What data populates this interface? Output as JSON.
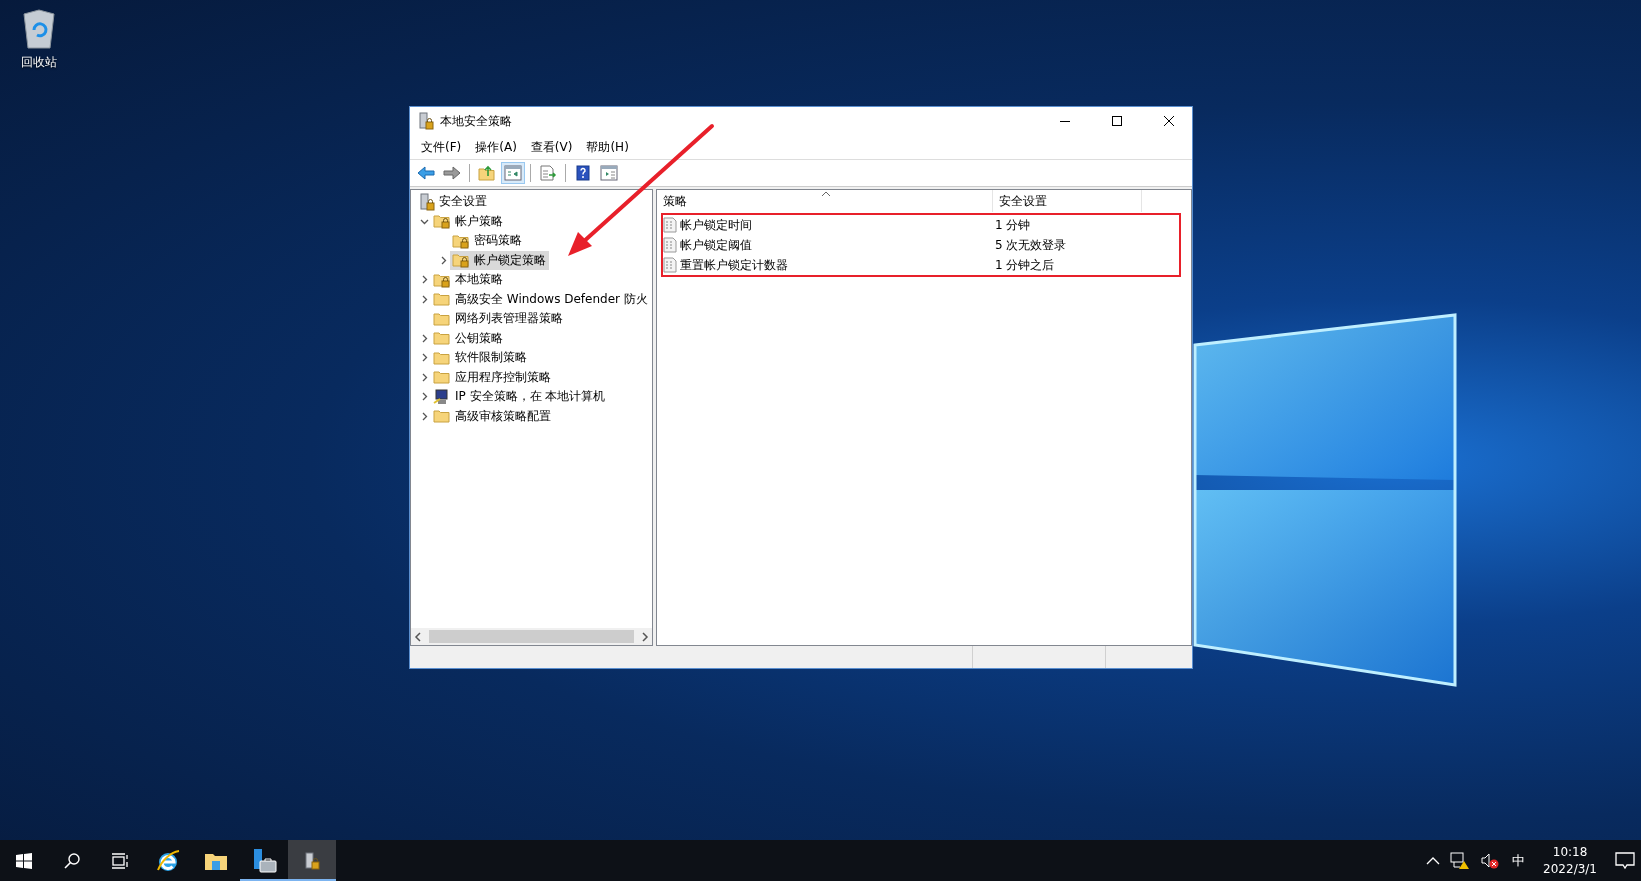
{
  "desktop": {
    "icons": [
      {
        "label": "回收站"
      }
    ]
  },
  "window": {
    "title": "本地安全策略",
    "menu": [
      "文件(F)",
      "操作(A)",
      "查看(V)",
      "帮助(H)"
    ],
    "toolbar": [
      {
        "kind": "back",
        "pressed": false
      },
      {
        "kind": "forward",
        "pressed": false
      },
      {
        "kind": "sep"
      },
      {
        "kind": "up",
        "pressed": false
      },
      {
        "kind": "tree",
        "pressed": true
      },
      {
        "kind": "sep"
      },
      {
        "kind": "export",
        "pressed": false
      },
      {
        "kind": "sep"
      },
      {
        "kind": "help",
        "pressed": false
      },
      {
        "kind": "view",
        "pressed": false
      }
    ],
    "tree": {
      "label": "安全设置",
      "kind": "root",
      "selected": false,
      "children": [
        {
          "label": "帐户策略",
          "kind": "lock",
          "expanded": true,
          "selected": false,
          "children": [
            {
              "label": "密码策略",
              "kind": "lock",
              "selected": false
            },
            {
              "label": "帐户锁定策略",
              "kind": "lock",
              "expanded": false,
              "selected": true
            }
          ]
        },
        {
          "label": "本地策略",
          "kind": "lock",
          "expanded": false,
          "selected": false
        },
        {
          "label": "高级安全 Windows Defender 防火",
          "kind": "folder",
          "expanded": false,
          "selected": false
        },
        {
          "label": "网络列表管理器策略",
          "kind": "folder",
          "selected": false
        },
        {
          "label": "公钥策略",
          "kind": "folder",
          "expanded": false,
          "selected": false
        },
        {
          "label": "软件限制策略",
          "kind": "folder",
          "expanded": false,
          "selected": false
        },
        {
          "label": "应用程序控制策略",
          "kind": "folder",
          "expanded": false,
          "selected": false
        },
        {
          "label": "IP 安全策略，在 本地计算机",
          "kind": "ip",
          "expanded": false,
          "selected": false
        },
        {
          "label": "高级审核策略配置",
          "kind": "folder",
          "expanded": false,
          "selected": false
        }
      ]
    },
    "table": {
      "columns": [
        "策略",
        "安全设置"
      ],
      "rows": [
        {
          "policy": "帐户锁定时间",
          "setting": "1 分钟"
        },
        {
          "policy": "帐户锁定阈值",
          "setting": "5 次无效登录"
        },
        {
          "policy": "重置帐户锁定计数器",
          "setting": "1 分钟之后"
        }
      ]
    }
  },
  "taskbar": {
    "apps": [
      {
        "kind": "ie",
        "running": false,
        "selected": false
      },
      {
        "kind": "explorer",
        "running": false,
        "selected": false
      },
      {
        "kind": "server",
        "running": true,
        "selected": false
      },
      {
        "kind": "policy",
        "running": true,
        "selected": true
      }
    ],
    "tray": {
      "ime": "中",
      "time": "10:18",
      "date": "2022/3/1"
    }
  }
}
